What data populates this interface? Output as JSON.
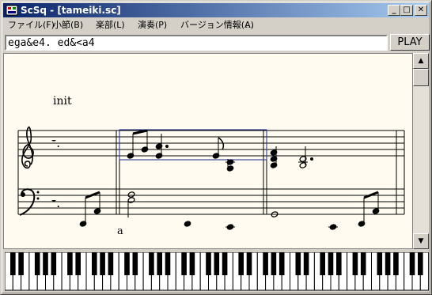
{
  "window": {
    "title": "ScSq - [tameiki.sc]",
    "controls": {
      "minimize": "_",
      "maximize": "□",
      "close": "✕"
    }
  },
  "menu": {
    "items": [
      {
        "label": "ファイル(F)"
      },
      {
        "label": "小節(B)"
      },
      {
        "label": "楽部(L)"
      },
      {
        "label": "演奏(P)"
      },
      {
        "label": "バージョン情報(A)"
      },
      {
        "label": "..."
      }
    ]
  },
  "toolbar": {
    "mml_value": "ega&e4. ed&<a4",
    "play_label": "PLAY"
  },
  "score": {
    "section_label": "init",
    "marker_label": "a",
    "treble_rest": "𝄻.",
    "bass_rest": "𝄻."
  },
  "scrollbar": {
    "up": "▲",
    "down": "▼"
  },
  "colors": {
    "title_start": "#0a246a",
    "title_end": "#a6caf0",
    "paper": "#fffbf0",
    "selection": "#1a2a8a"
  },
  "icons": {
    "app": "app-icon",
    "scroll_up": "arrow-up-icon",
    "scroll_down": "arrow-down-icon"
  }
}
